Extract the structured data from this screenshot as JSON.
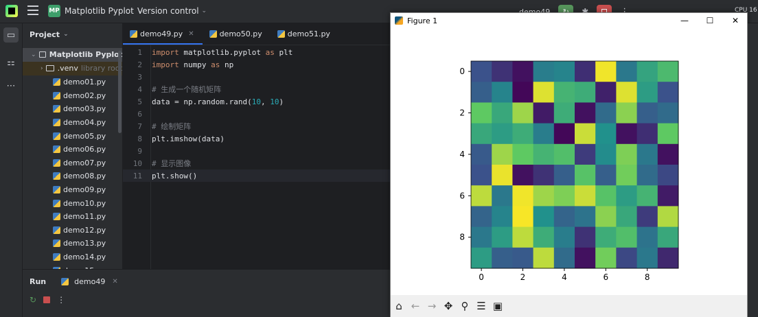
{
  "titlebar": {
    "project_badge": "MP",
    "project_name": "Matplotlib Pyplot",
    "vcs": "Version control",
    "run_config": "demo49",
    "sys_text": "CPU 16"
  },
  "toolstrip": {
    "icons": [
      "folder-icon",
      "structure-icon",
      "more-icon"
    ]
  },
  "project_panel": {
    "title": "Project",
    "root": "Matplotlib Pyplot",
    "venv": ".venv",
    "venv_note": "library root",
    "files": [
      "demo01.py",
      "demo02.py",
      "demo03.py",
      "demo04.py",
      "demo05.py",
      "demo06.py",
      "demo07.py",
      "demo08.py",
      "demo09.py",
      "demo10.py",
      "demo11.py",
      "demo12.py",
      "demo13.py",
      "demo14.py",
      "demo15.py"
    ]
  },
  "editor": {
    "tabs": [
      "demo49.py",
      "demo50.py",
      "demo51.py"
    ],
    "active_tab": 0,
    "lines": [
      {
        "n": "1",
        "parts": [
          {
            "t": "import",
            "c": "kw"
          },
          {
            "t": " matplotlib.pyplot ",
            "c": ""
          },
          {
            "t": "as",
            "c": "kw"
          },
          {
            "t": " plt",
            "c": ""
          }
        ]
      },
      {
        "n": "2",
        "parts": [
          {
            "t": "import",
            "c": "kw"
          },
          {
            "t": " numpy ",
            "c": ""
          },
          {
            "t": "as",
            "c": "kw"
          },
          {
            "t": " np",
            "c": ""
          }
        ]
      },
      {
        "n": "3",
        "parts": []
      },
      {
        "n": "4",
        "parts": [
          {
            "t": "# 生成一个随机矩阵",
            "c": "cm"
          }
        ]
      },
      {
        "n": "5",
        "parts": [
          {
            "t": "data = np.random.rand(",
            "c": ""
          },
          {
            "t": "10",
            "c": "num"
          },
          {
            "t": ", ",
            "c": ""
          },
          {
            "t": "10",
            "c": "num"
          },
          {
            "t": ")",
            "c": ""
          }
        ]
      },
      {
        "n": "6",
        "parts": []
      },
      {
        "n": "7",
        "parts": [
          {
            "t": "# 绘制矩阵",
            "c": "cm"
          }
        ]
      },
      {
        "n": "8",
        "parts": [
          {
            "t": "plt.imshow(data)",
            "c": ""
          }
        ]
      },
      {
        "n": "9",
        "parts": []
      },
      {
        "n": "10",
        "parts": [
          {
            "t": "# 显示图像",
            "c": "cm"
          }
        ]
      },
      {
        "n": "11",
        "parts": [
          {
            "t": "plt.show()",
            "c": ""
          }
        ]
      }
    ]
  },
  "runpanel": {
    "title": "Run",
    "tab": "demo49"
  },
  "figure": {
    "title": "Figure 1",
    "toolbar": [
      "home-icon",
      "back-icon",
      "forward-icon",
      "pan-icon",
      "zoom-icon",
      "configure-icon",
      "save-icon"
    ]
  },
  "chart_data": {
    "type": "heatmap",
    "colormap": "viridis",
    "xticks": [
      0,
      2,
      4,
      6,
      8
    ],
    "yticks": [
      0,
      2,
      4,
      6,
      8
    ],
    "values": [
      [
        0.25,
        0.15,
        0.05,
        0.42,
        0.45,
        0.14,
        0.98,
        0.4,
        0.58,
        0.68
      ],
      [
        0.3,
        0.45,
        0.02,
        0.95,
        0.65,
        0.62,
        0.1,
        0.95,
        0.55,
        0.25
      ],
      [
        0.75,
        0.6,
        0.85,
        0.08,
        0.62,
        0.05,
        0.35,
        0.82,
        0.3,
        0.35
      ],
      [
        0.6,
        0.55,
        0.62,
        0.42,
        0.02,
        0.92,
        0.5,
        0.05,
        0.14,
        0.75
      ],
      [
        0.28,
        0.85,
        0.75,
        0.65,
        0.7,
        0.18,
        0.48,
        0.8,
        0.4,
        0.05
      ],
      [
        0.25,
        0.97,
        0.05,
        0.15,
        0.3,
        0.72,
        0.3,
        0.78,
        0.35,
        0.22
      ],
      [
        0.9,
        0.4,
        0.98,
        0.85,
        0.8,
        0.92,
        0.72,
        0.55,
        0.65,
        0.08
      ],
      [
        0.32,
        0.45,
        0.99,
        0.5,
        0.32,
        0.38,
        0.82,
        0.6,
        0.18,
        0.88
      ],
      [
        0.4,
        0.55,
        0.9,
        0.62,
        0.42,
        0.15,
        0.62,
        0.7,
        0.38,
        0.6
      ],
      [
        0.55,
        0.3,
        0.28,
        0.9,
        0.35,
        0.05,
        0.78,
        0.22,
        0.4,
        0.12
      ]
    ]
  }
}
